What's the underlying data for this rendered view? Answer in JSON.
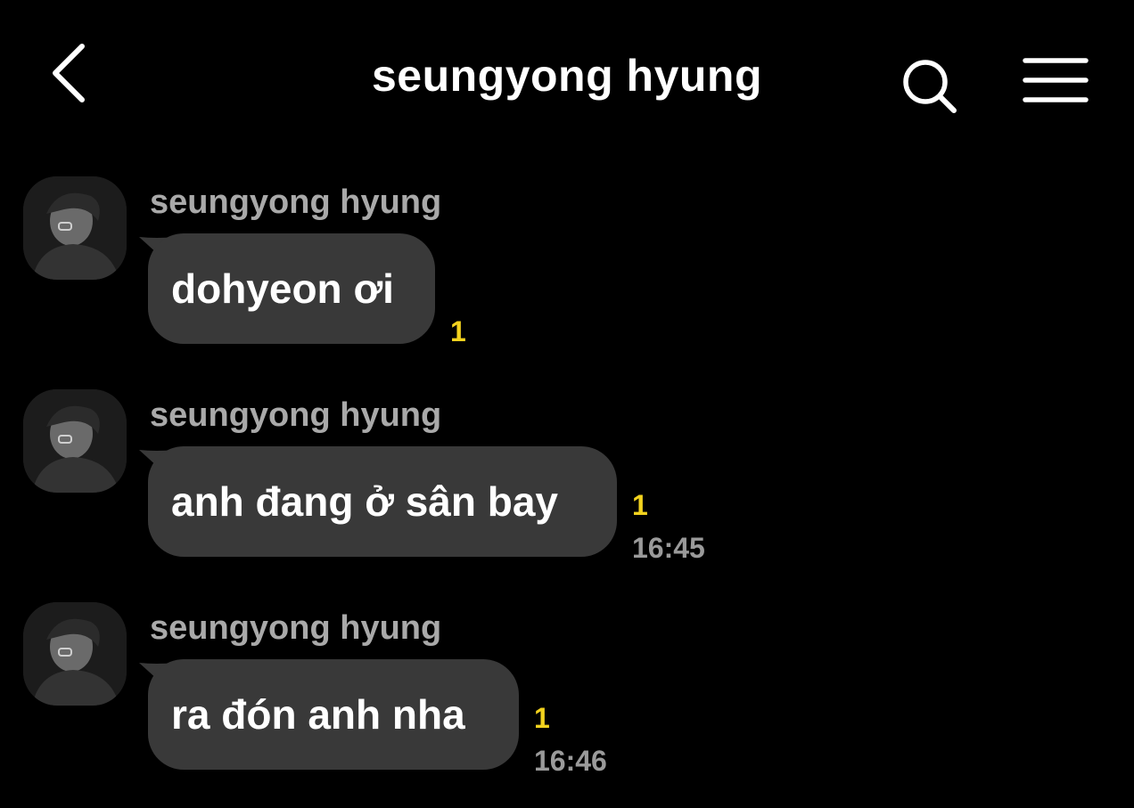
{
  "header": {
    "title": "seungyong hyung",
    "back_icon": "chevron-left-icon",
    "search_icon": "search-icon",
    "menu_icon": "hamburger-menu-icon"
  },
  "colors": {
    "background": "#000000",
    "bubble": "#393939",
    "unread": "#f2d21e",
    "time": "#9a9a9a",
    "sender": "#a9a9a9"
  },
  "messages": [
    {
      "sender": "seungyong hyung",
      "text": "dohyeon ơi",
      "unread": "1",
      "time": ""
    },
    {
      "sender": "seungyong hyung",
      "text": "anh đang ở sân bay",
      "unread": "1",
      "time": "16:45"
    },
    {
      "sender": "seungyong hyung",
      "text": "ra đón anh nha",
      "unread": "1",
      "time": "16:46"
    }
  ]
}
